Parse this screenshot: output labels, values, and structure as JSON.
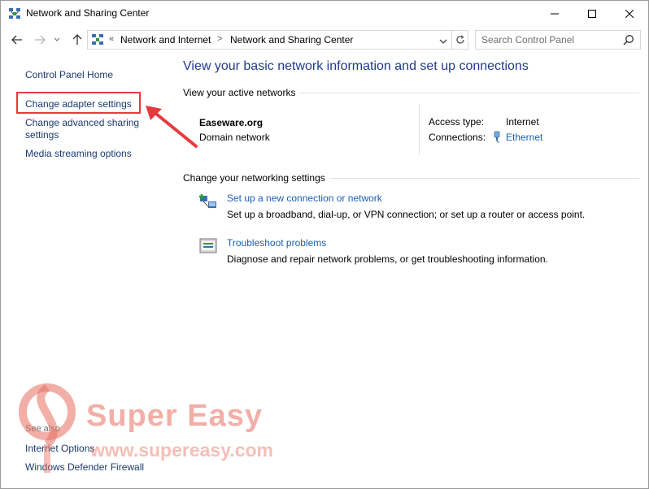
{
  "window": {
    "title": "Network and Sharing Center"
  },
  "address": {
    "breadcrumb": [
      "Network and Internet",
      "Network and Sharing Center"
    ],
    "overflow_glyph": "«",
    "separator_glyph": ">"
  },
  "search": {
    "placeholder": "Search Control Panel"
  },
  "sidebar": {
    "home": "Control Panel Home",
    "items": [
      {
        "label": "Change adapter settings"
      },
      {
        "label": "Change advanced sharing settings"
      },
      {
        "label": "Media streaming options"
      }
    ],
    "see_also_heading": "See also",
    "see_also": [
      {
        "label": "Internet Options"
      },
      {
        "label": "Windows Defender Firewall"
      }
    ]
  },
  "main": {
    "title": "View your basic network information and set up connections",
    "active_networks_heading": "View your active networks",
    "network": {
      "name": "Easeware.org",
      "type": "Domain network",
      "access_type_label": "Access type:",
      "access_type_value": "Internet",
      "connections_label": "Connections:",
      "connections_value": "Ethernet"
    },
    "change_heading": "Change your networking settings",
    "tasks": [
      {
        "link": "Set up a new connection or network",
        "description": "Set up a broadband, dial-up, or VPN connection; or set up a router or access point.",
        "icon": "new-connection-icon"
      },
      {
        "link": "Troubleshoot problems",
        "description": "Diagnose and repair network problems, or get troubleshooting information.",
        "icon": "troubleshoot-icon"
      }
    ]
  },
  "watermark": {
    "brand": "Super Easy",
    "url": "www.supereasy.com"
  },
  "colors": {
    "link": "#1a5fb4",
    "title": "#1e3b8a",
    "annotation": "#e63a3f"
  }
}
